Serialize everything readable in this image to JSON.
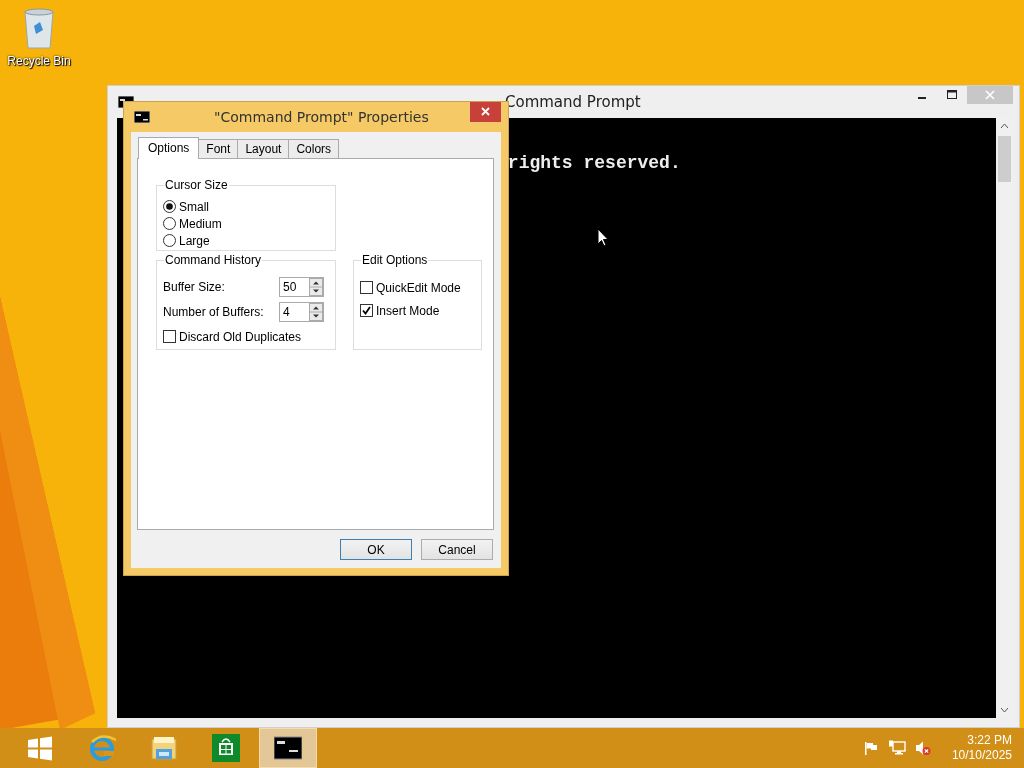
{
  "desktop": {
    "icons": [
      {
        "label": "Recycle Bin"
      }
    ]
  },
  "console_window": {
    "title": "Command Prompt",
    "lines": [
      {
        "text": "rights reserved."
      }
    ]
  },
  "properties_dialog": {
    "title": "\"Command Prompt\" Properties",
    "tabs": [
      {
        "label": "Options",
        "selected": true
      },
      {
        "label": "Font",
        "selected": false
      },
      {
        "label": "Layout",
        "selected": false
      },
      {
        "label": "Colors",
        "selected": false
      }
    ],
    "cursor_size": {
      "label": "Cursor Size",
      "options": [
        {
          "label": "Small",
          "selected": true
        },
        {
          "label": "Medium",
          "selected": false
        },
        {
          "label": "Large",
          "selected": false
        }
      ]
    },
    "command_history": {
      "label": "Command History",
      "fields": [
        {
          "label": "Buffer Size:",
          "value": "50"
        },
        {
          "label": "Number of Buffers:",
          "value": "4"
        }
      ],
      "checkboxes": [
        {
          "label": "Discard Old Duplicates",
          "checked": false
        }
      ]
    },
    "edit_options": {
      "label": "Edit Options",
      "checkboxes": [
        {
          "label": "QuickEdit Mode",
          "checked": false
        },
        {
          "label": "Insert Mode",
          "checked": true
        }
      ]
    },
    "buttons": [
      {
        "label": "OK",
        "default": true
      },
      {
        "label": "Cancel",
        "default": false
      }
    ]
  },
  "taskbar": {
    "apps": [
      {
        "kind": "start",
        "selected": false
      },
      {
        "kind": "browser",
        "selected": false
      },
      {
        "kind": "files",
        "selected": false
      },
      {
        "kind": "store",
        "selected": false
      },
      {
        "kind": "console",
        "selected": true
      }
    ],
    "clock": {
      "time": "3:22 PM",
      "date": "10/10/2025"
    }
  }
}
